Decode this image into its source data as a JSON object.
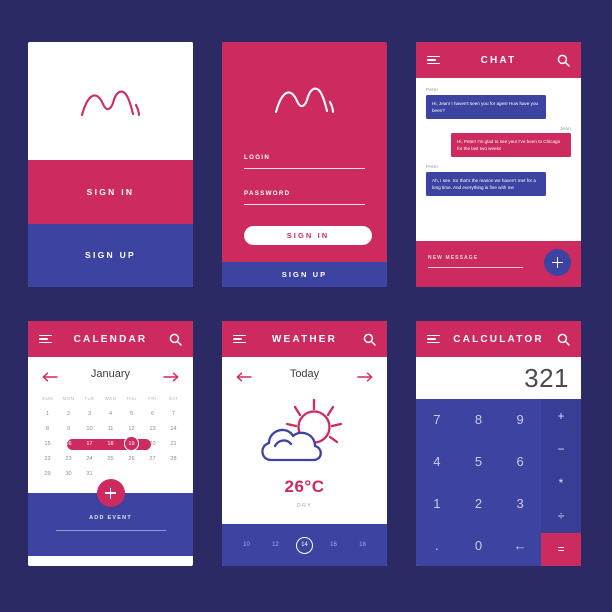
{
  "theme": {
    "background": "#2b2a64",
    "crimson": "#cd2a5f",
    "indigo": "#3d43a0",
    "white": "#ffffff"
  },
  "signin_screen": {
    "logo": "wave-logo",
    "sign_in_label": "SIGN IN",
    "sign_up_label": "SIGN UP"
  },
  "login_screen": {
    "logo": "wave-logo",
    "login_label": "LOGIN",
    "login_value": "",
    "password_label": "PASSWORD",
    "password_value": "",
    "sign_in_label": "SIGN IN",
    "sign_up_label": "SIGN UP"
  },
  "chat_screen": {
    "title": "CHAT",
    "messages": [
      {
        "sender": "Peter",
        "side": "them",
        "text": "Hi, Jean! I haven't seen you for ages! How have you been?"
      },
      {
        "sender": "Jean",
        "side": "me",
        "text": "Hi, Peter! I'm glad to see you! I've been to Chicago for the last two weeks"
      },
      {
        "sender": "Peter",
        "side": "them",
        "text": "Ah, I see. So that's the reason we haven't met for a long time. And everything is fine with me"
      }
    ],
    "new_message_placeholder": "NEW MESSAGE",
    "new_message_value": "",
    "send_button": "+"
  },
  "calendar_screen": {
    "title": "CALENDAR",
    "month": "January",
    "weekdays": [
      "SUN",
      "MON",
      "TUE",
      "WED",
      "THU",
      "FRI",
      "SAT"
    ],
    "weeks": [
      [
        "1",
        "2",
        "3",
        "4",
        "5",
        "6",
        "7"
      ],
      [
        "8",
        "9",
        "10",
        "11",
        "12",
        "13",
        "14"
      ],
      [
        "15",
        "16",
        "17",
        "18",
        "19",
        "20",
        "21"
      ],
      [
        "22",
        "23",
        "24",
        "25",
        "26",
        "27",
        "28"
      ],
      [
        "29",
        "30",
        "31",
        "",
        "",
        "",
        ""
      ]
    ],
    "range_days": [
      "16",
      "17",
      "18",
      "19"
    ],
    "selected_day": "19",
    "add_event_label": "ADD EVENT",
    "add_button": "+"
  },
  "weather_screen": {
    "title": "WEATHER",
    "day": "Today",
    "icon": "sun-behind-cloud-icon",
    "temperature": "26°C",
    "condition": "DRY",
    "hours": [
      "10",
      "12",
      "14",
      "16",
      "18"
    ],
    "selected_hour": "14"
  },
  "calculator_screen": {
    "title": "CALCULATOR",
    "display": "321",
    "keys": [
      "7",
      "8",
      "9",
      "4",
      "5",
      "6",
      "1",
      "2",
      "3",
      ".",
      "0",
      "←"
    ],
    "operators": [
      "+",
      "−",
      "*",
      "÷",
      "="
    ]
  }
}
